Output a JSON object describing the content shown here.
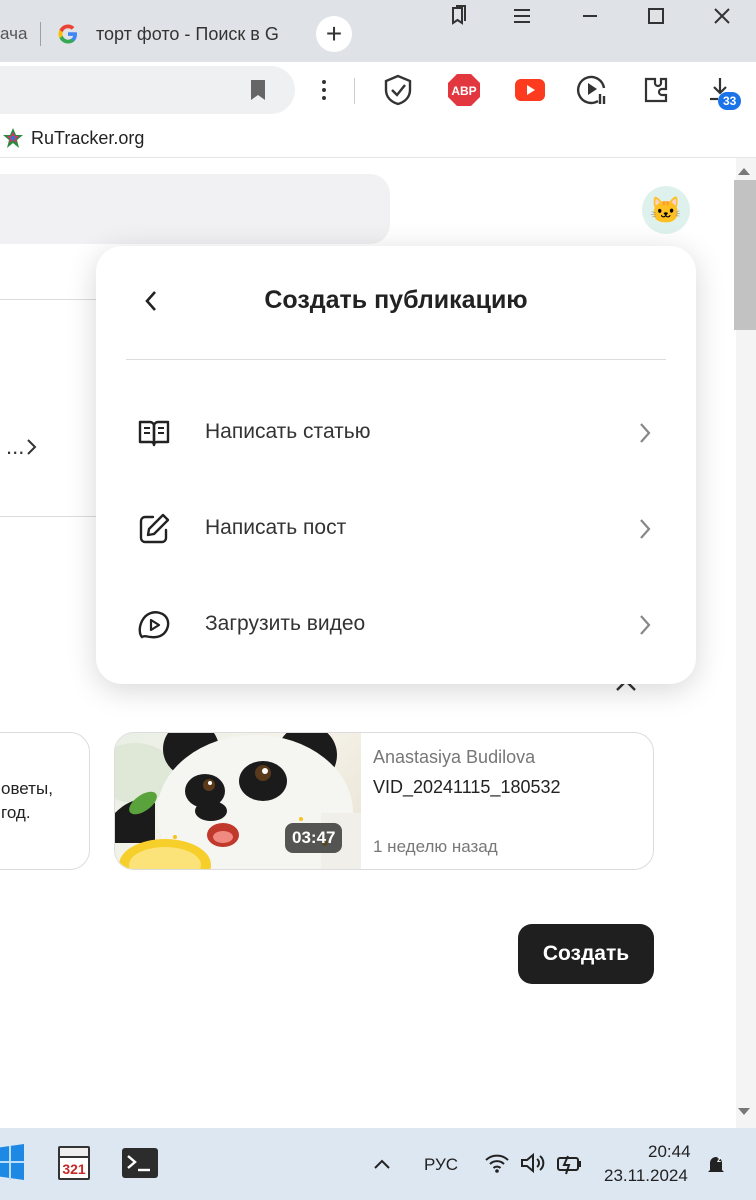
{
  "browser": {
    "tabs": [
      {
        "title": "ача"
      },
      {
        "title": "торт фото - Поиск в G",
        "icon": "google-icon"
      }
    ],
    "new_tab_label": "+",
    "download_badge": "33",
    "extensions": [
      "shield-check-icon",
      "adblock-plus-icon",
      "youtube-icon",
      "video-player-icon",
      "puzzle-icon",
      "download-icon"
    ],
    "bookmarks": [
      {
        "label": "RuTracker.org",
        "icon": "rutracker-icon"
      }
    ]
  },
  "page": {
    "avatar_emoji": "🐱",
    "ellipsis": "...",
    "card_left_text": [
      "оветы,",
      "год."
    ],
    "video_card": {
      "author": "Anastasiya Budilova",
      "title": "VID_20241115_180532",
      "duration": "03:47",
      "time_ago": "1 неделю назад"
    },
    "create_button": "Создать"
  },
  "popup": {
    "title": "Создать публикацию",
    "items": [
      {
        "label": "Написать статью",
        "icon": "open-book-icon"
      },
      {
        "label": "Написать пост",
        "icon": "pencil-edit-icon"
      },
      {
        "label": "Загрузить видео",
        "icon": "video-play-icon"
      }
    ]
  },
  "taskbar": {
    "language": "РУС",
    "time": "20:44",
    "date": "23.11.2024",
    "app_icons": [
      "windows-defender-icon",
      "media-player-classic-icon",
      "terminal-icon"
    ],
    "tray_icons": [
      "chevron-up-icon",
      "wifi-icon",
      "volume-icon",
      "battery-icon",
      "notification-icon"
    ]
  },
  "colors": {
    "accent_dark": "#1f1f1f",
    "badge_blue": "#1a73e8",
    "abp_red": "#e2373f",
    "youtube_red": "#ff3b1f"
  }
}
